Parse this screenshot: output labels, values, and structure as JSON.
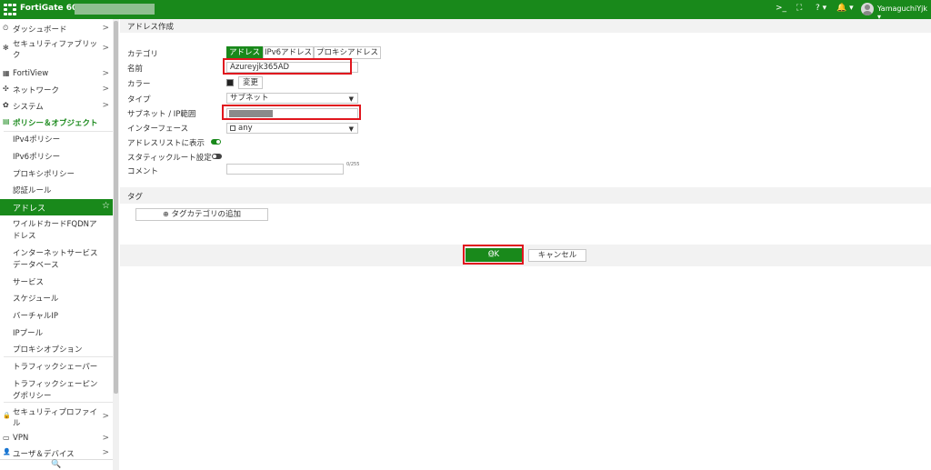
{
  "topbar": {
    "product": "FortiGate 60E",
    "icons": [
      "cli-console-icon",
      "fullscreen-icon",
      "help-icon",
      "notifications-icon"
    ],
    "cli_glyph": ">_",
    "fullscreen_glyph": "⛶",
    "help_glyph": "? ▾",
    "bell_glyph": "🔔 ▾",
    "username": "YamaguchiYjk ▾"
  },
  "sidebar": {
    "items": [
      {
        "icon": "dashboard-icon",
        "glyph": "⏲",
        "label": "ダッシュボード"
      },
      {
        "icon": "security-fabric-icon",
        "glyph": "✻",
        "label": "セキュリティファブリッ"
      },
      {
        "label_cont": "ク"
      },
      {
        "icon": "fortiview-icon",
        "glyph": "▦",
        "label": "FortiView"
      },
      {
        "icon": "network-icon",
        "glyph": "✣",
        "label": "ネットワーク"
      },
      {
        "icon": "system-icon",
        "glyph": "✿",
        "label": "システム"
      },
      {
        "icon": "policy-objects-icon",
        "glyph": "▤",
        "label": "ポリシー＆オブジェクト"
      }
    ],
    "subitems": [
      "IPv4ポリシー",
      "IPv6ポリシー",
      "プロキシポリシー",
      "認証ルール",
      "アドレス",
      "ワイルドカードFQDNア",
      "ドレス",
      "インターネットサービス",
      "データベース",
      "サービス",
      "スケジュール",
      "バーチャルIP",
      "IPプール",
      "プロキシオプション",
      "トラフィックシェーパー",
      "トラフィックシェーピン",
      "グポリシー"
    ],
    "bottom": [
      {
        "icon": "security-profile-icon",
        "glyph": "🔒",
        "label": "セキュリティプロファイ",
        "cont": "ル"
      },
      {
        "icon": "vpn-icon",
        "glyph": "▭",
        "label": "VPN"
      },
      {
        "icon": "user-device-icon",
        "glyph": "👤",
        "label": "ユーザ＆デバイス"
      }
    ],
    "star": "☆",
    "chevron": ">",
    "search_glyph": "🔍"
  },
  "form": {
    "header": "アドレス作成",
    "labels": {
      "category": "カテゴリ",
      "name": "名前",
      "color": "カラー",
      "type": "タイプ",
      "subnet": "サブネット / IP範囲",
      "interface": "インターフェース",
      "show_in_list": "アドレスリストに表示",
      "static_route": "スタティックルート設定",
      "comment": "コメント"
    },
    "category_tabs": [
      "アドレス",
      "IPv6アドレス",
      "プロキシアドレス"
    ],
    "name_value": "Azureyjk365AD",
    "color_button": "変更",
    "type_value": "サブネット",
    "interface_value": "any",
    "comment_counter": "0/255",
    "show_in_list": true,
    "static_route": false
  },
  "tags": {
    "header": "タグ",
    "add_button": "タグカテゴリの追加"
  },
  "footer": {
    "ok_label": "OK",
    "cancel_label": "キャンセル"
  },
  "colors": {
    "brand": "#19891b",
    "highlight": "#e0161e"
  }
}
